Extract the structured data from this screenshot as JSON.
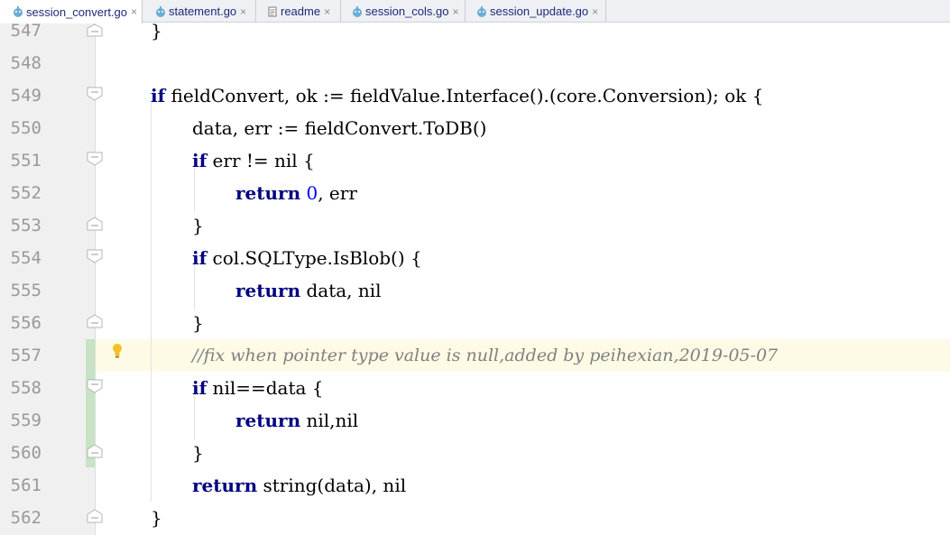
{
  "tabs": [
    {
      "label": "session_convert.go",
      "active": true,
      "icon": "go-file-icon"
    },
    {
      "label": "statement.go",
      "active": false,
      "icon": "go-file-icon"
    },
    {
      "label": "readme",
      "active": false,
      "icon": "text-file-icon"
    },
    {
      "label": "session_cols.go",
      "active": false,
      "icon": "go-file-icon"
    },
    {
      "label": "session_update.go",
      "active": false,
      "icon": "go-file-icon"
    }
  ],
  "tab_close_glyph": "×",
  "line_numbers": [
    "547",
    "548",
    "549",
    "550",
    "551",
    "552",
    "553",
    "554",
    "555",
    "556",
    "557",
    "558",
    "559",
    "560",
    "561",
    "562"
  ],
  "code": {
    "l547": {
      "brace": "}"
    },
    "l549": {
      "kw": "if",
      "rest": " fieldConvert, ok := fieldValue.Interface().(core.Conversion); ok {"
    },
    "l550": {
      "text": "data, err := fieldConvert.ToDB()"
    },
    "l551": {
      "kw": "if",
      "rest": " err != nil {"
    },
    "l552": {
      "kw": "return",
      "num": "0",
      "rest": ", err"
    },
    "l553": {
      "brace": "}"
    },
    "l554": {
      "kw": "if",
      "rest": " col.SQLType.IsBlob() {"
    },
    "l555": {
      "kw": "return",
      "rest": " data, nil"
    },
    "l556": {
      "brace": "}"
    },
    "l557": {
      "comment": "//fix when pointer type value is null,added by peihexian,2019-05-07"
    },
    "l558": {
      "kw": "if",
      "rest": " nil==data {"
    },
    "l559": {
      "kw": "return",
      "rest": " nil,nil"
    },
    "l560": {
      "brace": "}"
    },
    "l561": {
      "kw": "return",
      "rest": " string(data), nil"
    },
    "l562": {
      "brace": "}"
    }
  },
  "colors": {
    "keyword": "#000080",
    "number": "#0000ff",
    "comment": "#808080",
    "current_line": "#fdfbe5",
    "gutter": "#f0f0f0",
    "change_marker": "#c7e3c4",
    "bulb": "#f2c027"
  },
  "icons": {
    "intention_bulb": "lightbulb-icon",
    "fold": "fold-marker-icon"
  }
}
